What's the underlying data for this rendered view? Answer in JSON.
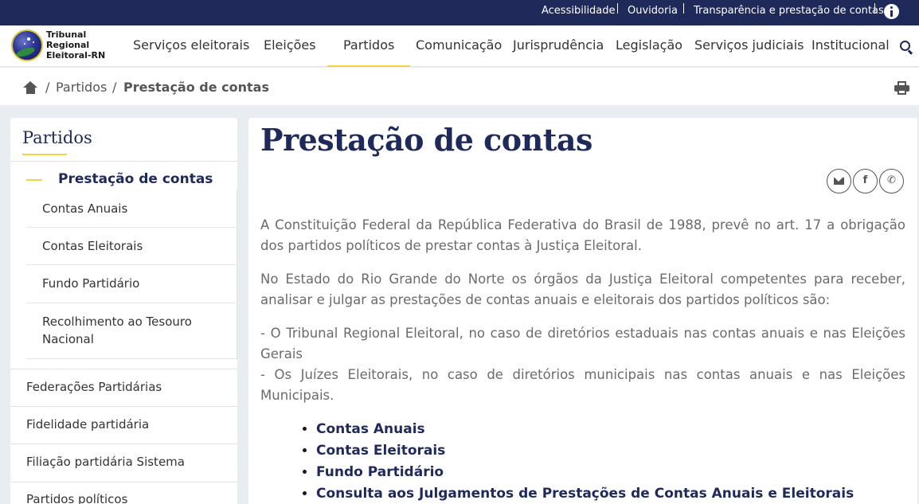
{
  "topbar": {
    "links": [
      "Acessibilidade",
      "Ouvidoria",
      "Transparência e prestação de contas"
    ],
    "info_icon": "info-icon"
  },
  "brand": {
    "line1": "Tribunal",
    "line2": "Regional",
    "line3": "Eleitoral-RN"
  },
  "nav": {
    "items": [
      "Serviços eleitorais",
      "Eleições",
      "Partidos",
      "Comunicação",
      "Jurisprudência",
      "Legislação",
      "Serviços judiciais",
      "Institucional"
    ],
    "active": "Partidos"
  },
  "breadcrumb": {
    "items": [
      "Partidos",
      "Prestação de contas"
    ]
  },
  "sidebar": {
    "title": "Partidos",
    "active_item": "Prestação de contas",
    "sub_items": [
      "Contas Anuais",
      "Contas Eleitorais",
      "Fundo Partidário",
      "Recolhimento ao Tesouro Nacional"
    ],
    "items": [
      "Federações Partidárias",
      "Fidelidade partidária",
      "Filiação partidária Sistema",
      "Partidos políticos"
    ]
  },
  "content": {
    "title": "Prestação de contas",
    "share_icons": [
      "envelope-icon",
      "facebook-icon",
      "whatsapp-icon"
    ],
    "paragraphs": [
      "A Constituição Federal da República Federativa do Brasil de 1988, prevê no art. 17 a obrigação dos partidos políticos de prestar contas à Justiça Eleitoral.",
      "No Estado do Rio Grande do Norte os órgãos da Justiça Eleitoral competentes para receber, analisar e julgar as prestações de contas anuais e eleitorais dos partidos políticos são:",
      "- O Tribunal Regional Eleitoral, no caso de diretórios estaduais nas contas anuais e nas Eleições Gerais",
      "- Os Juízes Eleitorais, no caso de diretórios municipais nas contas anuais e nas Eleições Municipais."
    ],
    "links": [
      "Contas Anuais",
      "Contas Eleitorais",
      "Fundo Partidário",
      "Consulta aos Julgamentos de Prestações de Contas Anuais e Eleitorais"
    ]
  },
  "colors": {
    "primary": "#1f2a5a",
    "accent": "#f2d24b",
    "page_bg": "#e9edf2"
  }
}
